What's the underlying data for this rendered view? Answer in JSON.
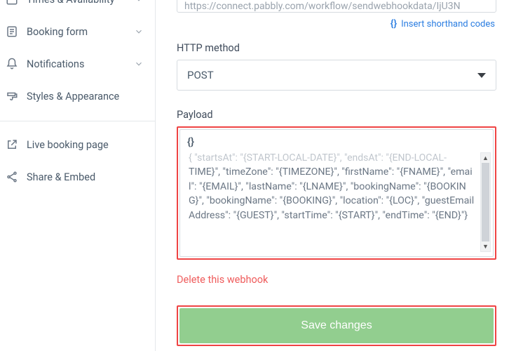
{
  "sidebar": {
    "items": [
      {
        "label": "Times & Availability"
      },
      {
        "label": "Booking form"
      },
      {
        "label": "Notifications"
      },
      {
        "label": "Styles & Appearance"
      },
      {
        "label": "Live booking page"
      },
      {
        "label": "Share & Embed"
      }
    ]
  },
  "form": {
    "url_value": "https://connect.pabbly.com/workflow/sendwebhookdata/IjU3N",
    "insert_link": "Insert shorthand codes",
    "http_method_label": "HTTP method",
    "http_method_value": "POST",
    "payload_label": "Payload",
    "payload_braces": "{}",
    "payload_fade": "{ \"startsAt\": \"{START-LOCAL-DATE}\", \"endsAt\": \"{END-LOCAL-",
    "payload_text": "TIME}\", \"timeZone\": \"{TIMEZONE}\", \"firstName\": \"{FNAME}\", \"email\": \"{EMAIL}\", \"lastName\": \"{LNAME}\", \"bookingName\": \"{BOOKING}\", \"bookingName\": \"{BOOKING}\", \"location\": \"{LOC}\", \"guestEmailAddress\": \"{GUEST}\", \"startTime\": \"{START}\", \"endTime\": \"{END}\"}",
    "delete_link": "Delete this webhook",
    "save_label": "Save changes"
  },
  "colors": {
    "accent_red": "#ef4444",
    "link_blue": "#2a7de1",
    "save_green": "#92ce8f"
  }
}
